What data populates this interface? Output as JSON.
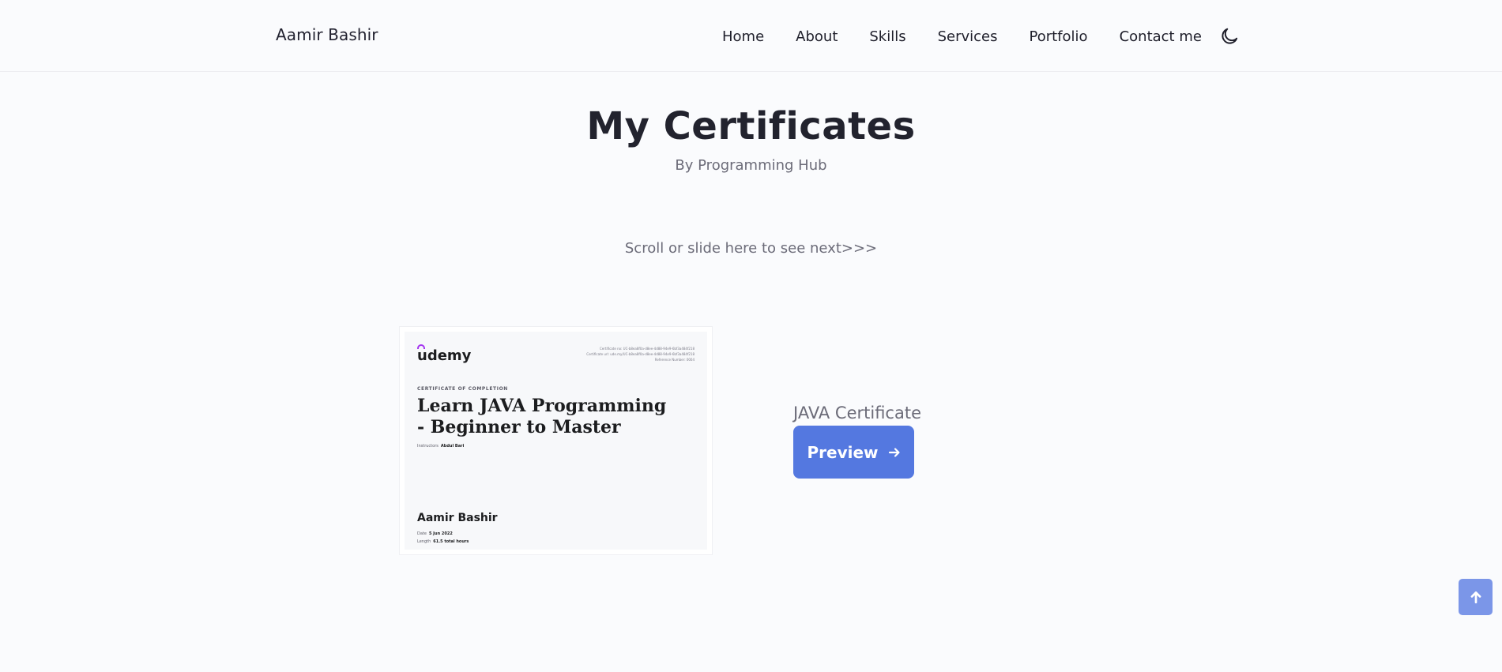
{
  "header": {
    "logo": "Aamir Bashir",
    "nav": [
      "Home",
      "About",
      "Skills",
      "Services",
      "Portfolio",
      "Contact me"
    ],
    "theme_icon": "moon-icon"
  },
  "main": {
    "title": "My Certificates",
    "subtitle": "By Programming Hub",
    "scroll_hint": "Scroll or slide here to see next>>>"
  },
  "certificate": {
    "provider": "udemy",
    "ids": [
      "Certificate no: UC-b8ea8f0a-d8ee-4d88-94e9-6bf3a484f218",
      "Certificate url: ude.my/UC-b8ea8f0a-d8ee-4d88-94e9-6bf3a484f218",
      "Reference Number: 0004"
    ],
    "heading": "CERTIFICATE OF COMPLETION",
    "course": "Learn JAVA Programming - Beginner to Master",
    "instructor_label": "Instructors",
    "instructor": "Abdul Bari",
    "recipient": "Aamir Bashir",
    "date_label": "Date",
    "date": "5 Jun 2022",
    "length_label": "Length",
    "length": "61.5 total hours",
    "label": "JAVA Certificate",
    "button": "Preview",
    "button_icon": "arrow-right-icon"
  },
  "scroll_top_icon": "arrow-up-icon",
  "colors": {
    "accent": "#5478e0",
    "scroll_top": "#7b96e8",
    "udemy_purple": "#a435f0"
  }
}
